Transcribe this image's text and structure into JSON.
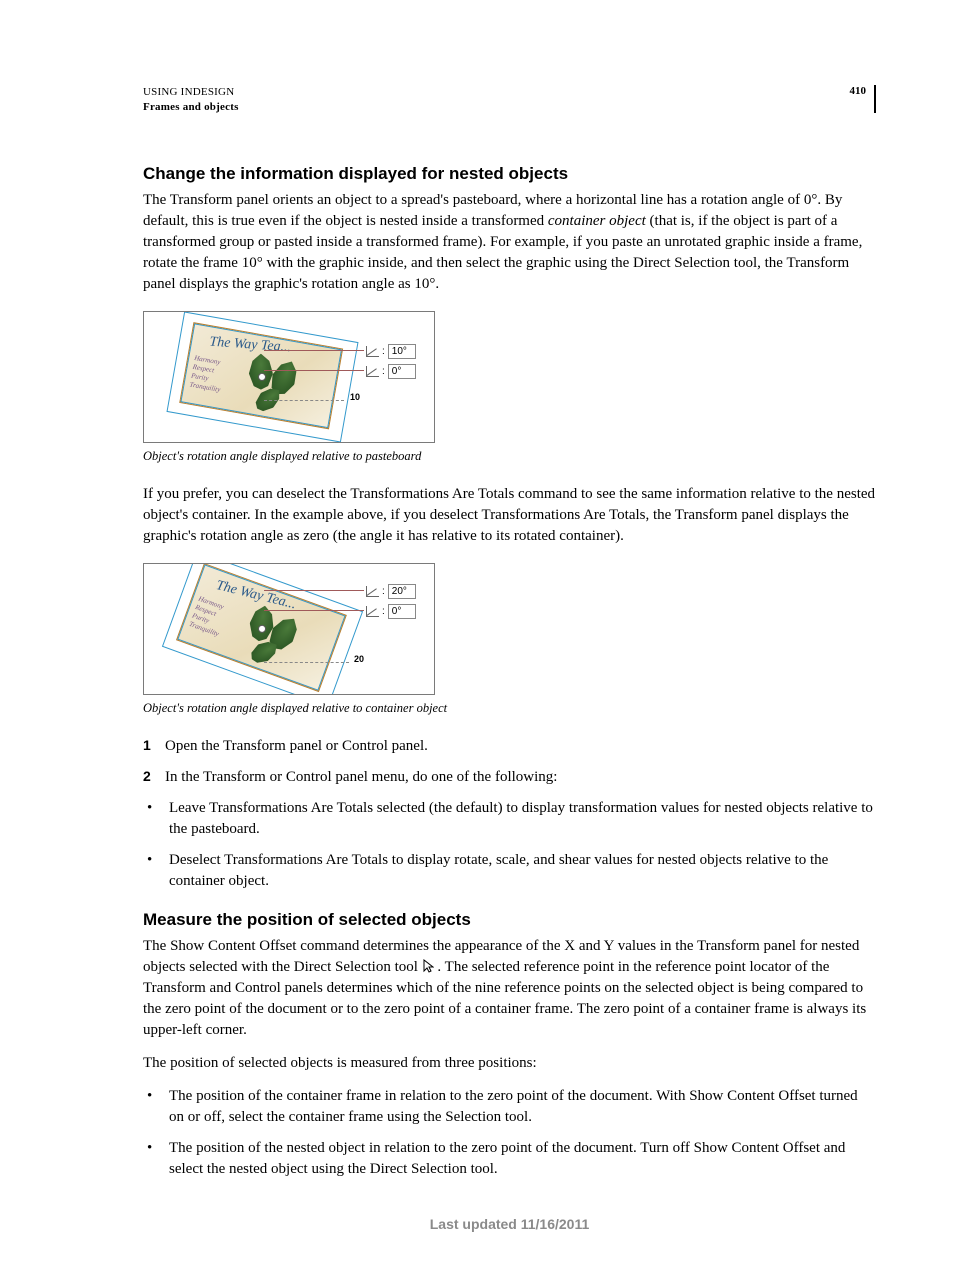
{
  "header": {
    "running": "USING INDESIGN",
    "section": "Frames and objects",
    "page_number": "410"
  },
  "section1": {
    "heading": "Change the information displayed for nested objects",
    "para1_a": "The Transform panel orients an object to a spread's pasteboard, where a horizontal line has a rotation angle of 0°. By default, this is true even if the object is nested inside a transformed ",
    "para1_italic": "container object",
    "para1_b": " (that is, if the object is part of a transformed group or pasted inside a transformed frame). For example, if you paste an unrotated graphic inside a frame, rotate the frame 10° with the graphic inside, and then select the graphic using the Direct Selection tool, the Transform panel displays the graphic's rotation angle as 10°.",
    "fig1": {
      "card_title": "The Way Tea...",
      "words": [
        "Harmony",
        "Respect",
        "Purity",
        "Tranquility"
      ],
      "box_top": "10°",
      "box_bottom": "0°",
      "angle_label": "10",
      "caption": "Object's rotation angle displayed relative to pasteboard"
    },
    "para2": "If you prefer, you can deselect the Transformations Are Totals command to see the same information relative to the nested object's container. In the example above, if you deselect Transformations Are Totals, the Transform panel displays the graphic's rotation angle as zero (the angle it has relative to its rotated container).",
    "fig2": {
      "card_title": "The Way Tea...",
      "words": [
        "Harmony",
        "Respect",
        "Purity",
        "Tranquility"
      ],
      "box_top": "20°",
      "box_bottom": "0°",
      "angle_label": "20",
      "caption": "Object's rotation angle displayed relative to container object"
    },
    "steps": [
      "Open the Transform panel or Control panel.",
      "In the Transform or Control panel menu, do one of the following:"
    ],
    "bullets": [
      "Leave Transformations Are Totals selected (the default) to display transformation values for nested objects relative to the pasteboard.",
      "Deselect Transformations Are Totals to display rotate, scale, and shear values for nested objects relative to the container object."
    ]
  },
  "section2": {
    "heading": "Measure the position of selected objects",
    "para1_a": "The Show Content Offset command determines the appearance of the X and Y values in the Transform panel for nested objects selected with the Direct Selection tool ",
    "para1_b": " . The selected reference point in the reference point locator of the Transform and Control panels determines which of the nine reference points on the selected object is being compared to the zero point of the document or to the zero point of a container frame. The zero point of a container frame is always its upper-left corner.",
    "para2": "The position of selected objects is measured from three positions:",
    "bullets": [
      "The position of the container frame in relation to the zero point of the document. With Show Content Offset turned on or off, select the container frame using the Selection tool.",
      "The position of the nested object in relation to the zero point of the document. Turn off Show Content Offset and select the nested object using the Direct Selection tool."
    ]
  },
  "footer": "Last updated 11/16/2011"
}
